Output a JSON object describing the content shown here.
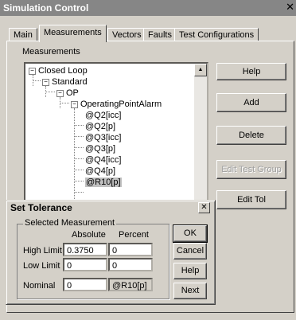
{
  "window": {
    "title": "Simulation Control",
    "close_glyph": "✕"
  },
  "tabs": [
    {
      "label": "Main"
    },
    {
      "label": "Measurements"
    },
    {
      "label": "Vectors"
    },
    {
      "label": "Faults"
    },
    {
      "label": "Test Configurations"
    }
  ],
  "measurements_label": "Measurements",
  "tree": [
    {
      "label": "Closed Loop",
      "expander": "−"
    },
    {
      "label": "Standard",
      "expander": "−"
    },
    {
      "label": "OP",
      "expander": "−"
    },
    {
      "label": "OperatingPointAlarm",
      "expander": "−"
    },
    {
      "label": "@Q2[icc]"
    },
    {
      "label": "@Q2[p]"
    },
    {
      "label": "@Q3[icc]"
    },
    {
      "label": "@Q3[p]"
    },
    {
      "label": "@Q4[icc]"
    },
    {
      "label": "@Q4[p]"
    },
    {
      "label": "@R10[p]",
      "selected": true
    }
  ],
  "buttons": {
    "help": "Help",
    "add": "Add",
    "delete": "Delete",
    "edit_test_group": "Edit Test Group",
    "edit_tol": "Edit Tol"
  },
  "dialog": {
    "title": "Set Tolerance",
    "close_glyph": "✕",
    "group_label": "Selected Measurement",
    "col_absolute": "Absolute",
    "col_percent": "Percent",
    "high_label": "High Limit",
    "low_label": "Low Limit",
    "nominal_label": "Nominal",
    "high_abs": "0.3750",
    "high_pct": "0",
    "low_abs": "0",
    "low_pct": "0",
    "nominal_val": "0",
    "nominal_name": "@R10[p]",
    "ok": "OK",
    "cancel": "Cancel",
    "help": "Help",
    "next": "Next"
  }
}
